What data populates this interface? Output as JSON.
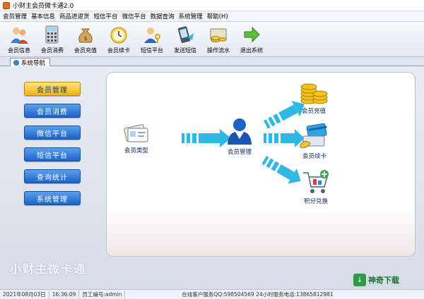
{
  "window": {
    "title": "小财主会员微卡通2.0"
  },
  "menu": [
    "会员管理",
    "基本信息",
    "商品进退货",
    "短信平台",
    "微信平台",
    "数据查询",
    "系统管理",
    "帮助(H)"
  ],
  "toolbar": [
    {
      "label": "会员信息",
      "icon": "members-icon"
    },
    {
      "label": "会员消费",
      "icon": "calculator-icon"
    },
    {
      "label": "会员充值",
      "icon": "money-bag-icon"
    },
    {
      "label": "会员续卡",
      "icon": "clock-icon"
    },
    {
      "label": "短信平台",
      "icon": "user-key-icon"
    },
    {
      "label": "发送短信",
      "icon": "phone-icon"
    },
    {
      "label": "操作流水",
      "icon": "coins-icon"
    },
    {
      "label": "退出系统",
      "icon": "exit-arrow-icon"
    }
  ],
  "tabs": {
    "active": "系统导航"
  },
  "nav": [
    "会员管理",
    "会员消费",
    "微信平台",
    "短信平台",
    "查询统计",
    "系统管理"
  ],
  "flow": {
    "type_label": "会员类型",
    "center_label": "会员管理",
    "recharge_label": "会员充值",
    "renew_label": "会员续卡",
    "exchange_label": "积分兑换"
  },
  "watermark": "小财主微卡通",
  "brand": "神奇下载",
  "status": {
    "date": "2021年08月03日",
    "time": "16:36:09",
    "employee": "员工编号:admin",
    "service": "在线客户服务QQ:598504569  24小时服务电话:13865812981"
  },
  "colors": {
    "nav_active": "#f3b21a",
    "nav_default": "#1d62c8",
    "arrow": "#2fb8e4"
  }
}
